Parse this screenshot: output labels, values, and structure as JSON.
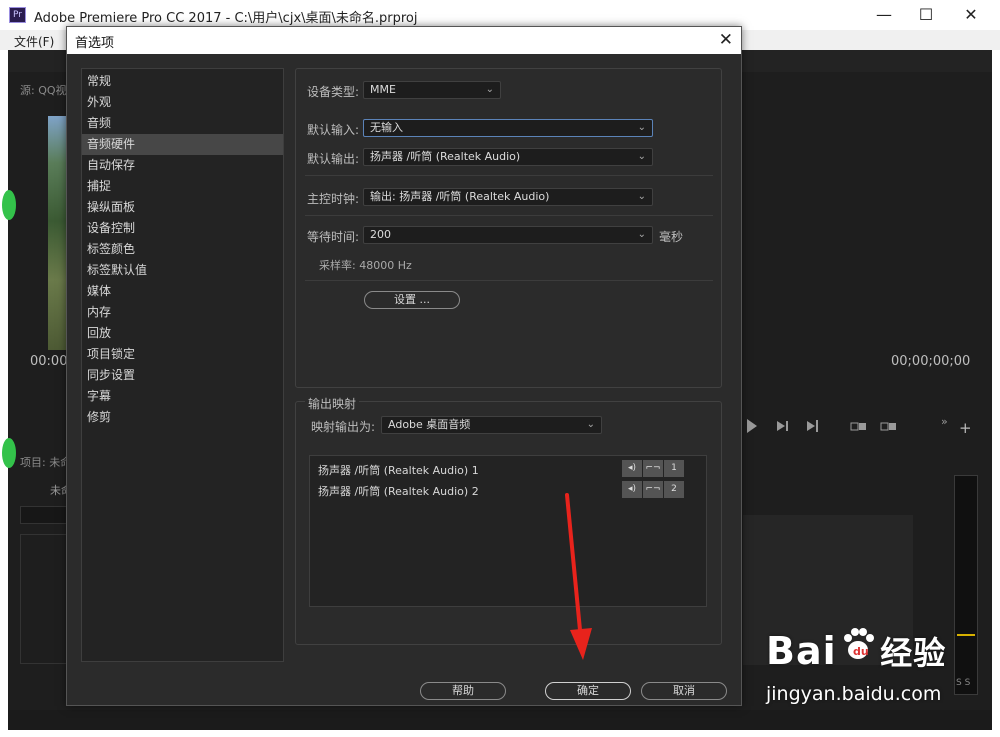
{
  "window": {
    "title": "Adobe Premiere Pro CC 2017 - C:\\用户\\cjx\\桌面\\未命名.prproj",
    "logo_text": "Pr",
    "minimize": "—",
    "maximize": "☐",
    "close": "✕"
  },
  "menu": {
    "file": "文件(F)"
  },
  "background": {
    "source_tab": "源: QQ视",
    "timecode_left": "00:00",
    "timecode_right": "00;00;00;00",
    "project_tab": "项目: 未命",
    "project_name": "未命",
    "meter_labels": "S S"
  },
  "dialog": {
    "title": "首选项",
    "close": "✕",
    "sidebar": [
      {
        "label": "常规",
        "selected": false
      },
      {
        "label": "外观",
        "selected": false
      },
      {
        "label": "音频",
        "selected": false
      },
      {
        "label": "音频硬件",
        "selected": true
      },
      {
        "label": "自动保存",
        "selected": false
      },
      {
        "label": "捕捉",
        "selected": false
      },
      {
        "label": "操纵面板",
        "selected": false
      },
      {
        "label": "设备控制",
        "selected": false
      },
      {
        "label": "标签颜色",
        "selected": false
      },
      {
        "label": "标签默认值",
        "selected": false
      },
      {
        "label": "媒体",
        "selected": false
      },
      {
        "label": "内存",
        "selected": false
      },
      {
        "label": "回放",
        "selected": false
      },
      {
        "label": "项目锁定",
        "selected": false
      },
      {
        "label": "同步设置",
        "selected": false
      },
      {
        "label": "字幕",
        "selected": false
      },
      {
        "label": "修剪",
        "selected": false
      }
    ],
    "device_type": {
      "label": "设备类型:",
      "value": "MME"
    },
    "default_input": {
      "label": "默认输入:",
      "value": "无输入"
    },
    "default_output": {
      "label": "默认输出:",
      "value": "扬声器 /听筒 (Realtek Audio)"
    },
    "master_clock": {
      "label": "主控时钟:",
      "value": "输出: 扬声器 /听筒 (Realtek Audio)"
    },
    "latency": {
      "label": "等待时间:",
      "value": "200",
      "unit": "毫秒"
    },
    "sample_rate": "采样率: 48000 Hz",
    "settings_button": "设置 ...",
    "output_mapping": {
      "group_label": "输出映射",
      "map_label": "映射输出为:",
      "map_value": "Adobe 桌面音频",
      "rows": [
        {
          "label": "扬声器 /听筒 (Realtek Audio) 1",
          "channel": "1"
        },
        {
          "label": "扬声器 /听筒 (Realtek Audio) 2",
          "channel": "2"
        }
      ]
    },
    "buttons": {
      "help": "帮助",
      "ok": "确定",
      "cancel": "取消"
    }
  },
  "watermark": {
    "brand": "Bai",
    "brand_cn": "经验",
    "url": "jingyan.baidu.com"
  },
  "colors": {
    "accent_arrow": "#e8231c",
    "selection": "#474747",
    "focus_border": "#5b83b8"
  }
}
